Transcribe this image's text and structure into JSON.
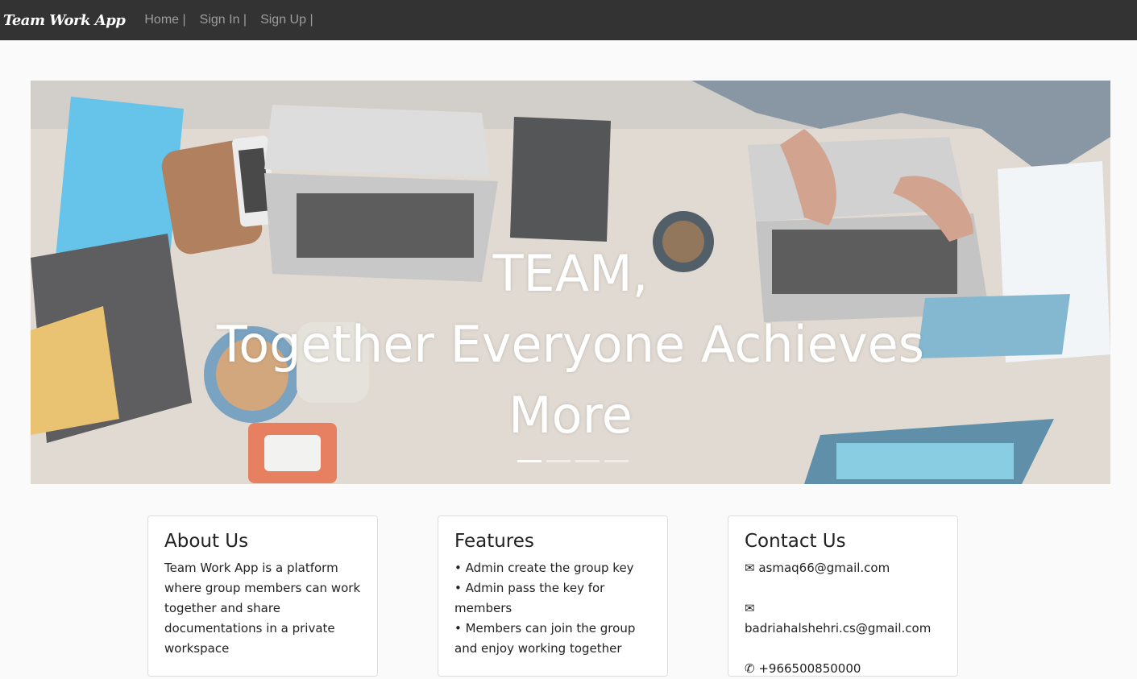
{
  "navbar": {
    "brand": "Team Work App",
    "links": [
      "Home |",
      "Sign In |",
      "Sign Up |"
    ]
  },
  "hero": {
    "caption_lines": [
      "TEAM,",
      "Together Everyone Achieves",
      "More"
    ],
    "indicator_count": 4,
    "active_indicator": 0
  },
  "about": {
    "title": "About Us",
    "text": "Team Work App is a platform where group members can work together and share documentations in a private workspace"
  },
  "features": {
    "title": "Features",
    "items": [
      "• Admin create the group key",
      "• Admin pass the key for members",
      "• Members can join the group and enjoy working together"
    ]
  },
  "contact": {
    "title": "Contact Us",
    "items": [
      "✉ asmaq66@gmail.com",
      "✉ badriahalshehri.cs@gmail.com",
      "✆ +966500850000"
    ]
  },
  "colors": {
    "navbar_bg": "#333333",
    "nav_link": "#9d9d9d",
    "page_bg": "#fafafa"
  }
}
